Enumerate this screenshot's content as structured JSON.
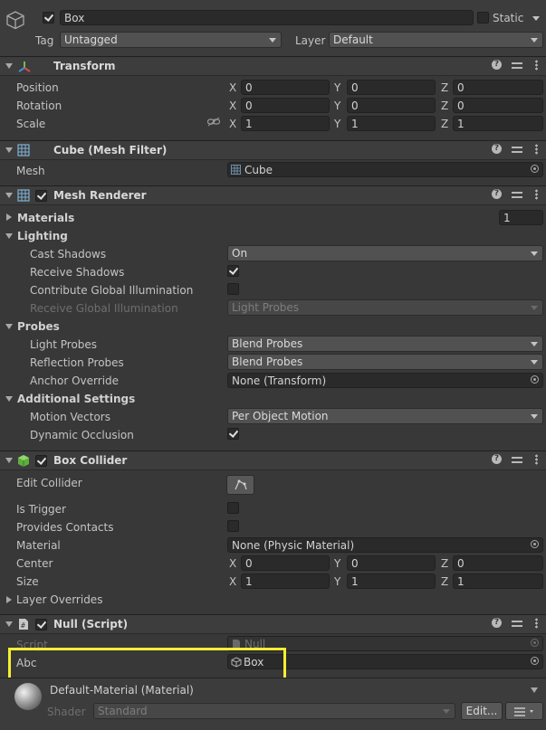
{
  "gameobject": {
    "name": "Box",
    "static_label": "Static",
    "tag_label": "Tag",
    "tag_value": "Untagged",
    "layer_label": "Layer",
    "layer_value": "Default"
  },
  "transform": {
    "title": "Transform",
    "position_label": "Position",
    "rotation_label": "Rotation",
    "scale_label": "Scale",
    "position": {
      "x": "0",
      "y": "0",
      "z": "0"
    },
    "rotation": {
      "x": "0",
      "y": "0",
      "z": "0"
    },
    "scale": {
      "x": "1",
      "y": "1",
      "z": "1"
    }
  },
  "axes": {
    "x": "X",
    "y": "Y",
    "z": "Z"
  },
  "mesh_filter": {
    "title": "Cube (Mesh Filter)",
    "mesh_label": "Mesh",
    "mesh_value": "Cube"
  },
  "mesh_renderer": {
    "title": "Mesh Renderer",
    "materials_label": "Materials",
    "materials_count": "1",
    "lighting_label": "Lighting",
    "cast_shadows_label": "Cast Shadows",
    "cast_shadows_value": "On",
    "receive_shadows_label": "Receive Shadows",
    "contribute_gi_label": "Contribute Global Illumination",
    "receive_gi_label": "Receive Global Illumination",
    "receive_gi_value": "Light Probes",
    "probes_label": "Probes",
    "light_probes_label": "Light Probes",
    "light_probes_value": "Blend Probes",
    "reflection_probes_label": "Reflection Probes",
    "reflection_probes_value": "Blend Probes",
    "anchor_override_label": "Anchor Override",
    "anchor_override_value": "None (Transform)",
    "additional_settings_label": "Additional Settings",
    "motion_vectors_label": "Motion Vectors",
    "motion_vectors_value": "Per Object Motion",
    "dynamic_occlusion_label": "Dynamic Occlusion"
  },
  "box_collider": {
    "title": "Box Collider",
    "edit_collider_label": "Edit Collider",
    "is_trigger_label": "Is Trigger",
    "provides_contacts_label": "Provides Contacts",
    "material_label": "Material",
    "material_value": "None (Physic Material)",
    "center_label": "Center",
    "size_label": "Size",
    "center": {
      "x": "0",
      "y": "0",
      "z": "0"
    },
    "size": {
      "x": "1",
      "y": "1",
      "z": "1"
    },
    "layer_overrides_label": "Layer Overrides"
  },
  "null_script": {
    "title": "Null (Script)",
    "script_label": "Script",
    "script_value": "Null",
    "abc_label": "Abc",
    "abc_value": "Box"
  },
  "material": {
    "title": "Default-Material (Material)",
    "shader_label": "Shader",
    "shader_value": "Standard",
    "edit_label": "Edit..."
  },
  "colors": {
    "highlight": "#f4ee33",
    "background": "#383838"
  }
}
